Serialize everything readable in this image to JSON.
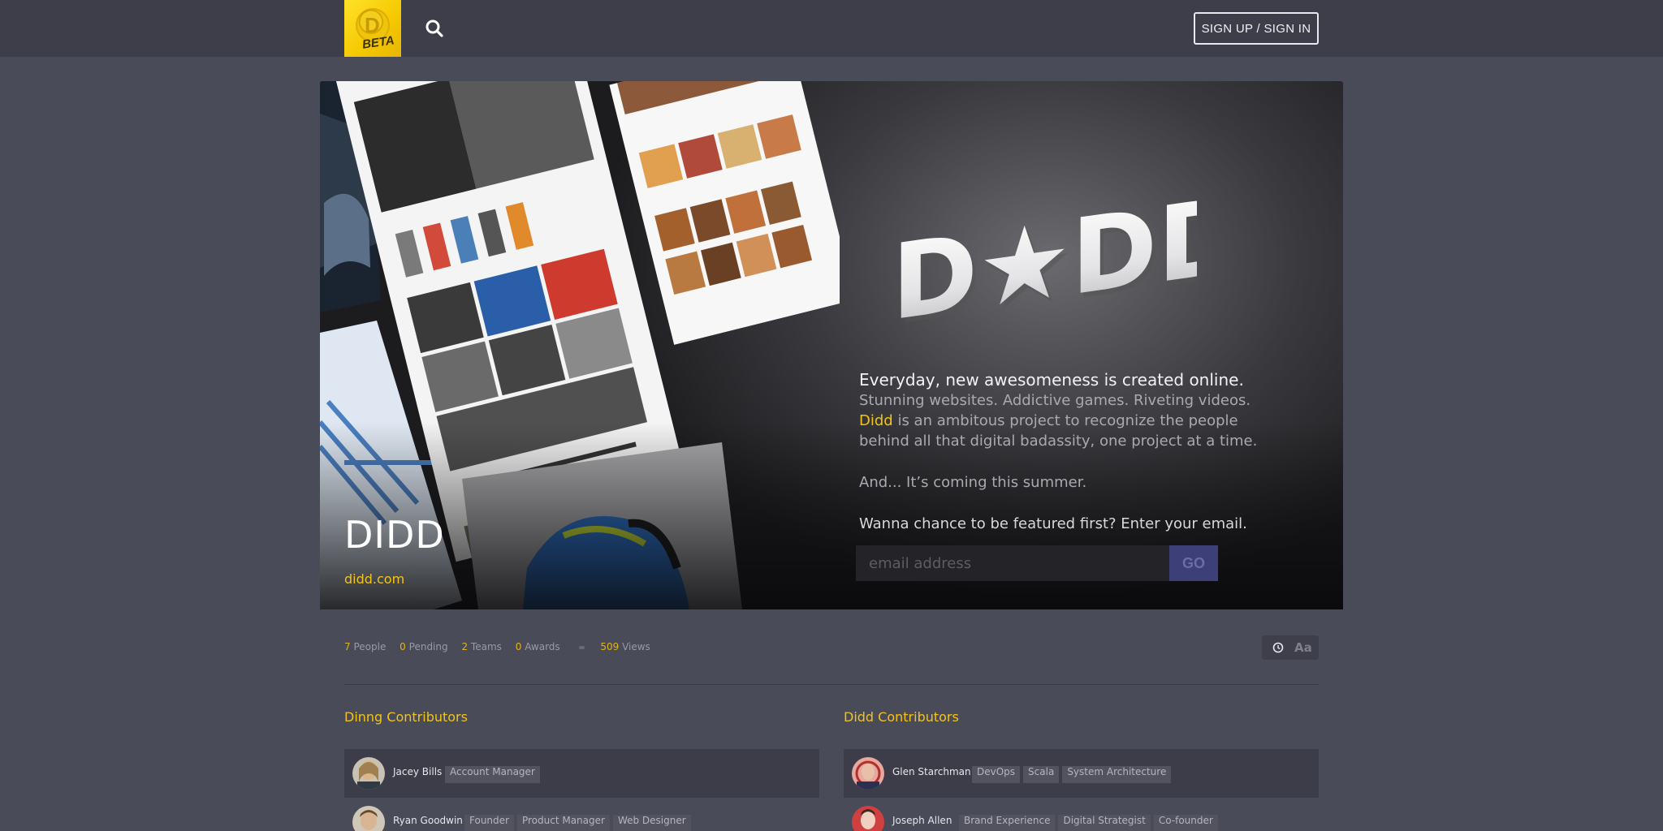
{
  "header": {
    "logo_badge": "BETA",
    "signin_label": "SIGN UP / SIGN IN"
  },
  "hero": {
    "title": "DIDD",
    "link": "didd.com",
    "brand_text": "D★DD",
    "lead": "Everyday, new awesomeness is created online.",
    "line2": "Stunning websites. Addictive games. Riveting videos.",
    "line3_accent": "Didd",
    "line3_rest": " is an ambitous project to recognize the people",
    "line4": "behind all that digital badassity, one project at a time.",
    "coming": "And... It’s coming this summer.",
    "ask": "Wanna chance to be featured first? Enter your email.",
    "email_placeholder": "email address",
    "go_label": "GO"
  },
  "stats": {
    "people_count": "7",
    "people_label": "People",
    "pending_count": "0",
    "pending_label": "Pending",
    "teams_count": "2",
    "teams_label": "Teams",
    "awards_count": "0",
    "awards_label": "Awards",
    "views_count": "509",
    "views_label": "Views",
    "font_toggle": "Aa"
  },
  "left_column": {
    "title": "Dinng Contributors",
    "people": [
      {
        "name": "Jacey Bills",
        "tags": [
          "Account Manager"
        ]
      },
      {
        "name": "Ryan Goodwin",
        "tags": [
          "Founder",
          "Product Manager",
          "Web Designer"
        ]
      }
    ]
  },
  "right_column": {
    "title": "Didd Contributors",
    "people": [
      {
        "name": "Glen Starchman",
        "tags": [
          "DevOps",
          "Scala",
          "System Architecture"
        ]
      },
      {
        "name": "Joseph Allen",
        "tags": [
          "Brand Experience",
          "Digital Strategist",
          "Co-founder"
        ]
      }
    ]
  },
  "colors": {
    "background": "#4a4b58",
    "topbar": "#3d3e4a",
    "accent": "#f3c417",
    "go_button": "#3d3f78"
  }
}
